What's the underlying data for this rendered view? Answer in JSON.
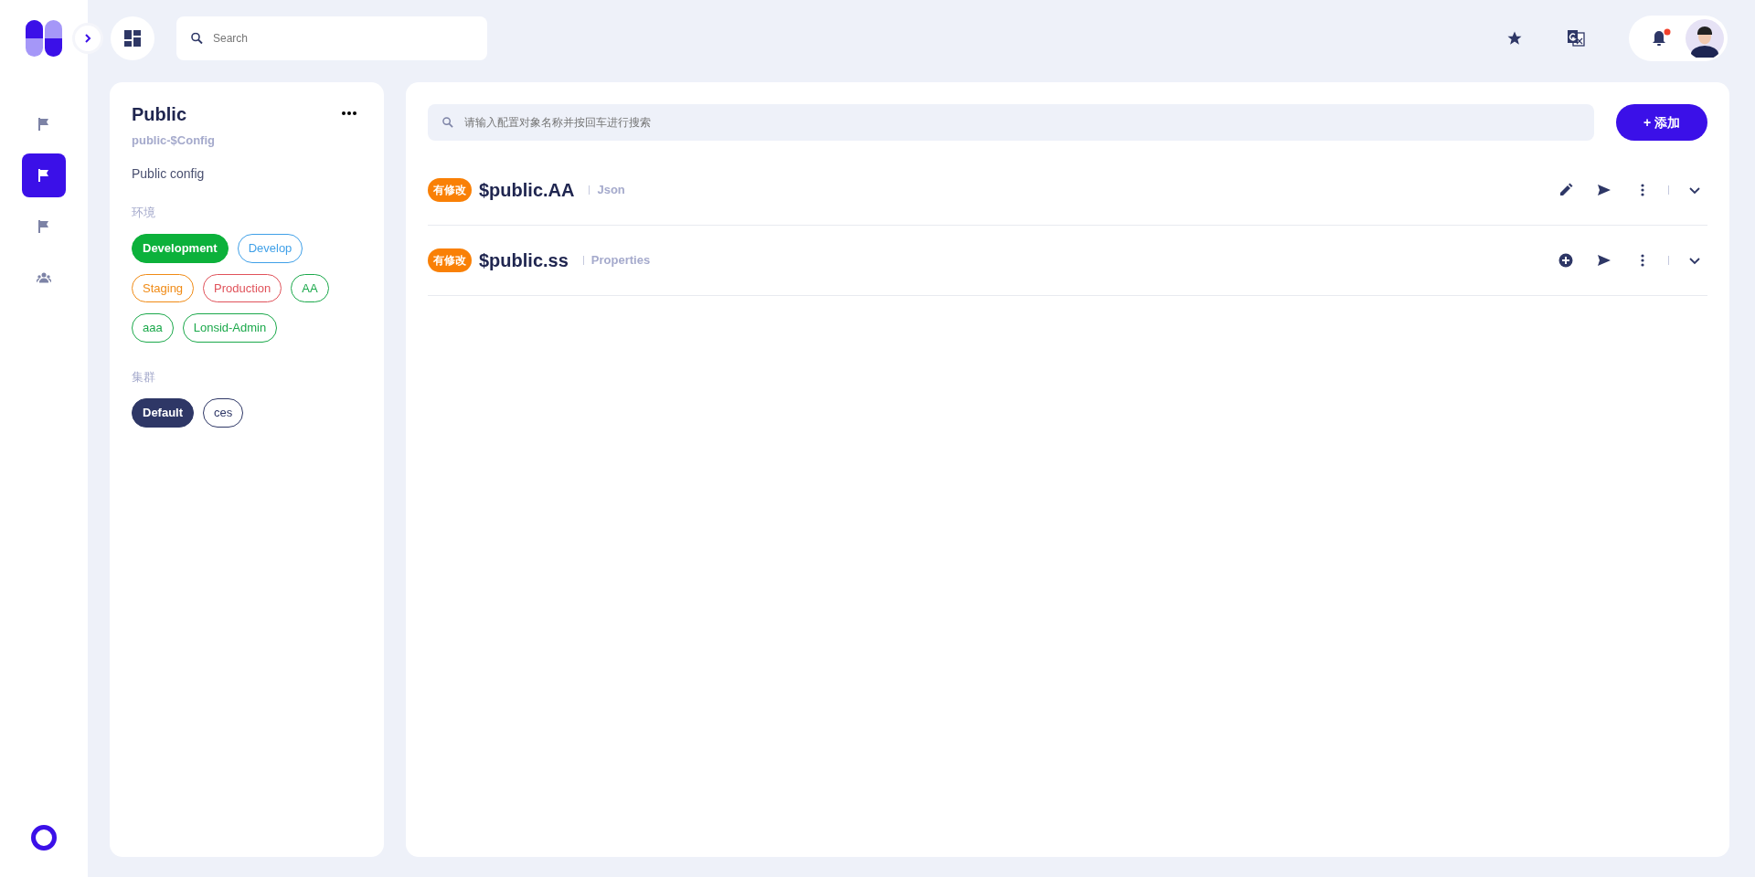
{
  "header": {
    "search": {
      "placeholder": "Search"
    },
    "notification": {
      "unread": true
    }
  },
  "sidebar": {
    "items": [
      {
        "kind": "flag",
        "selected": false
      },
      {
        "kind": "flag",
        "selected": true
      },
      {
        "kind": "flag",
        "selected": false
      },
      {
        "kind": "people",
        "selected": false
      }
    ]
  },
  "detail": {
    "title": "Public",
    "subtitle": "public-$Config",
    "description": "Public config",
    "environments": {
      "label": "环境",
      "tags": [
        {
          "label": "Development",
          "color": "#0cb13b",
          "selected": true
        },
        {
          "label": "Develop",
          "color": "#3fa0e8",
          "selected": false
        },
        {
          "label": "Staging",
          "color": "#f08a14",
          "selected": false
        },
        {
          "label": "Production",
          "color": "#e0525a",
          "selected": false
        },
        {
          "label": "AA",
          "color": "#1aa84a",
          "selected": false
        },
        {
          "label": "aaa",
          "color": "#1aa84a",
          "selected": false
        },
        {
          "label": "Lonsid-Admin",
          "color": "#1aa84a",
          "selected": false
        }
      ]
    },
    "clusters": {
      "label": "集群",
      "tags": [
        {
          "label": "Default",
          "color": "#2e3766",
          "selected": true
        },
        {
          "label": "ces",
          "color": "#2e3766",
          "selected": false
        }
      ]
    }
  },
  "main": {
    "search": {
      "placeholder": "请输入配置对象名称并按回车进行搜索"
    },
    "add_button": "+ 添加",
    "configs": [
      {
        "badge": "有修改",
        "name": "$public.AA",
        "type": "Json",
        "kind": "edit"
      },
      {
        "badge": "有修改",
        "name": "$public.ss",
        "type": "Properties",
        "kind": "add"
      }
    ]
  }
}
